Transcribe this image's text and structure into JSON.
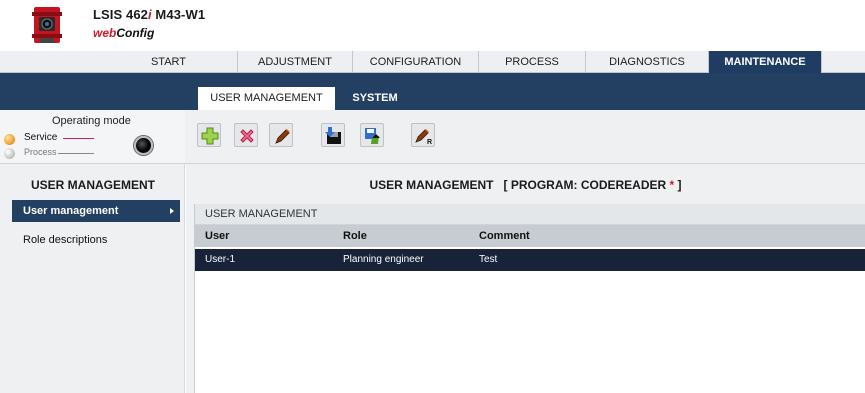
{
  "header": {
    "product_prefix": "LSIS 462",
    "product_i": "i",
    "product_suffix": " M43-W1",
    "web_part": "web",
    "config_part": "Config"
  },
  "main_nav": {
    "tabs": [
      {
        "label": "START",
        "active": false
      },
      {
        "label": "ADJUSTMENT",
        "active": false
      },
      {
        "label": "CONFIGURATION",
        "active": false
      },
      {
        "label": "PROCESS",
        "active": false
      },
      {
        "label": "DIAGNOSTICS",
        "active": false
      },
      {
        "label": "MAINTENANCE",
        "active": true
      }
    ]
  },
  "sub_nav": {
    "tabs": [
      {
        "label": "USER MANAGEMENT",
        "active": true
      },
      {
        "label": "SYSTEM",
        "active": false
      }
    ]
  },
  "operating_mode": {
    "title": "Operating mode",
    "service_label": "Service",
    "process_label": "Process",
    "selected": "Service"
  },
  "toolbar": {
    "buttons": [
      {
        "icon": "add-icon"
      },
      {
        "icon": "delete-icon"
      },
      {
        "icon": "edit-icon"
      },
      {
        "icon": "save-icon"
      },
      {
        "icon": "load-icon"
      },
      {
        "icon": "edit-role-icon",
        "badge": "R"
      }
    ]
  },
  "sidebar": {
    "title": "USER MANAGEMENT",
    "items": [
      {
        "label": "User management",
        "active": true
      },
      {
        "label": "Role descriptions",
        "active": false
      }
    ]
  },
  "content": {
    "title_main": "USER MANAGEMENT",
    "title_program": "[ PROGRAM: CODEREADER",
    "title_star": " *",
    "title_close": " ]",
    "panel_title": "USER MANAGEMENT",
    "table": {
      "headers": [
        "User",
        "Role",
        "Comment"
      ],
      "rows": [
        {
          "user": "User-1",
          "role": "Planning engineer",
          "comment": "Test",
          "selected": true
        }
      ]
    }
  },
  "colors": {
    "nav_dark": "#233f62",
    "accent_red": "#d01c2c",
    "selected_row": "#18233a"
  }
}
